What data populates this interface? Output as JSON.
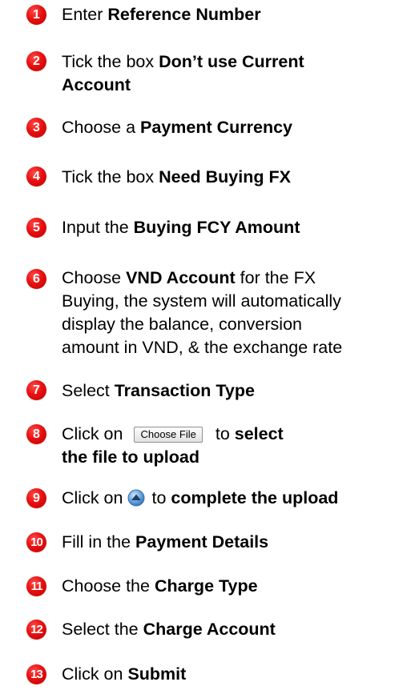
{
  "steps": [
    {
      "number": "1",
      "pre": "Enter ",
      "bold": "Reference Number"
    },
    {
      "number": "2",
      "pre": "Tick the box ",
      "bold": "Don’t use Current",
      "line2": "Account"
    },
    {
      "number": "3",
      "pre": "Choose a ",
      "bold": "Payment Currency"
    },
    {
      "number": "4",
      "pre": "Tick the box ",
      "bold": "Need Buying FX"
    },
    {
      "number": "5",
      "pre": "Input the ",
      "bold": "Buying FCY Amount"
    },
    {
      "number": "6",
      "pre": "Choose ",
      "bold": "VND Account",
      "post": " for the FX",
      "line2": "Buying, the system will automatically",
      "line3": "display the balance, conversion",
      "line4": "amount in VND, & the exchange rate"
    },
    {
      "number": "7",
      "pre": "Select ",
      "bold": "Transaction Type"
    },
    {
      "number": "8",
      "pre": "Click on",
      "button_label": "Choose File",
      "post": "to ",
      "bold": "select",
      "line2": "the file to upload"
    },
    {
      "number": "9",
      "pre": "Click on",
      "icon": "upload-arrow-icon",
      "post": "to ",
      "bold": "complete the upload"
    },
    {
      "number": "10",
      "pre": "Fill in the ",
      "bold": "Payment Details"
    },
    {
      "number": "11",
      "pre": "Choose the ",
      "bold": "Charge Type"
    },
    {
      "number": "12",
      "pre": "Select the ",
      "bold": "Charge Account"
    },
    {
      "number": "13",
      "pre": "Click on ",
      "bold": "Submit"
    }
  ],
  "colors": {
    "badge": "#e01010",
    "text": "#000000"
  }
}
